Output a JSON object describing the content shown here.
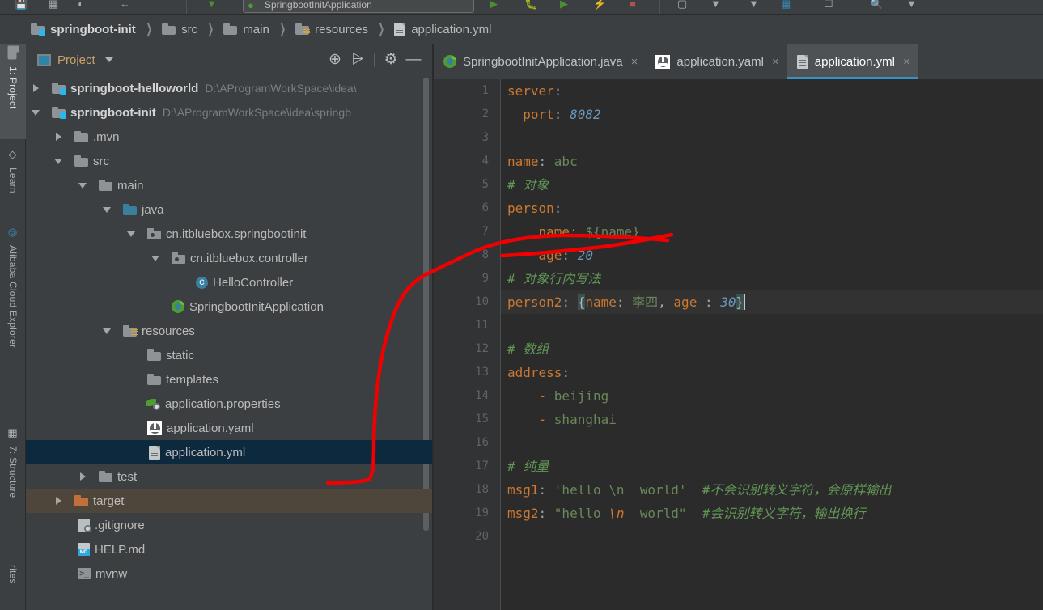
{
  "window": {
    "breadcrumb": [
      {
        "label": "springboot-init",
        "icon": "module-folder-icon",
        "bold": true
      },
      {
        "label": "src",
        "icon": "folder-icon",
        "bold": false
      },
      {
        "label": "main",
        "icon": "folder-icon",
        "bold": false
      },
      {
        "label": "resources",
        "icon": "resources-folder-icon",
        "bold": false
      },
      {
        "label": "application.yml",
        "icon": "yml-file-icon",
        "bold": false
      }
    ],
    "separator": "❯"
  },
  "toolbar": {
    "run_config_name": "SpringbootInitApplication",
    "icons": [
      "save-icon",
      "sync-icon",
      "history-icon",
      "back-icon",
      "forward-icon",
      "build-icon",
      "run-config-dropdown-icon",
      "run-icon",
      "debug-icon",
      "run-coverage-icon",
      "profile-icon",
      "stop-icon",
      "bookmark-icon",
      "search-everywhere-icon",
      "settings-icon",
      "project-structure-icon",
      "layout-icon",
      "search-icon",
      "user-icon"
    ]
  },
  "left_tool_window_bar": {
    "items": [
      {
        "label": "1: Project",
        "icon": "project-icon",
        "active": true
      },
      {
        "label": "Learn",
        "icon": "learn-icon",
        "active": false
      },
      {
        "label": "Alibaba Cloud Explorer",
        "icon": "cloud-icon",
        "active": false
      },
      {
        "label": "7: Structure",
        "icon": "structure-icon",
        "active": false
      },
      {
        "label": "rites",
        "icon": "favorites-icon",
        "active": false
      }
    ]
  },
  "project_panel": {
    "title": "Project",
    "title_caret": "▼",
    "tools": [
      {
        "name": "select-opened-file-icon",
        "glyph": "⊕"
      },
      {
        "name": "collapse-all-icon",
        "glyph": "⩥"
      },
      {
        "name": "settings-gear-icon",
        "glyph": "⚙"
      },
      {
        "name": "hide-panel-icon",
        "glyph": "—"
      }
    ],
    "tree": [
      {
        "indent": 0,
        "arrow": "right",
        "icon": "module-folder-icon",
        "label": "springboot-helloworld",
        "bold": true,
        "path": "D:\\AProgramWorkSpace\\idea\\",
        "state": "normal"
      },
      {
        "indent": 0,
        "arrow": "down",
        "icon": "module-folder-icon",
        "label": "springboot-init",
        "bold": true,
        "path": "D:\\AProgramWorkSpace\\idea\\springb",
        "state": "normal"
      },
      {
        "indent": 1,
        "arrow": "right",
        "icon": "folder-icon",
        "label": ".mvn",
        "bold": false,
        "path": "",
        "state": "normal"
      },
      {
        "indent": 1,
        "arrow": "down",
        "icon": "folder-icon",
        "label": "src",
        "bold": false,
        "path": "",
        "state": "normal"
      },
      {
        "indent": 2,
        "arrow": "down",
        "icon": "folder-icon",
        "label": "main",
        "bold": false,
        "path": "",
        "state": "normal"
      },
      {
        "indent": 3,
        "arrow": "down",
        "icon": "source-folder-icon",
        "label": "java",
        "bold": false,
        "path": "",
        "state": "normal"
      },
      {
        "indent": 4,
        "arrow": "down",
        "icon": "package-icon",
        "label": "cn.itbluebox.springbootinit",
        "bold": false,
        "path": "",
        "state": "normal"
      },
      {
        "indent": 5,
        "arrow": "down",
        "icon": "package-icon",
        "label": "cn.itbluebox.controller",
        "bold": false,
        "path": "",
        "state": "normal"
      },
      {
        "indent": 6,
        "arrow": "none",
        "icon": "java-class-icon",
        "label": "HelloController",
        "bold": false,
        "path": "",
        "state": "normal"
      },
      {
        "indent": 5,
        "arrow": "none",
        "icon": "spring-boot-icon",
        "label": "SpringbootInitApplication",
        "bold": false,
        "path": "",
        "state": "normal"
      },
      {
        "indent": 3,
        "arrow": "down",
        "icon": "resources-folder-icon",
        "label": "resources",
        "bold": false,
        "path": "",
        "state": "normal"
      },
      {
        "indent": 4,
        "arrow": "none",
        "icon": "folder-icon",
        "label": "static",
        "bold": false,
        "path": "",
        "state": "normal"
      },
      {
        "indent": 4,
        "arrow": "none",
        "icon": "folder-icon",
        "label": "templates",
        "bold": false,
        "path": "",
        "state": "normal"
      },
      {
        "indent": 4,
        "arrow": "none",
        "icon": "properties-file-icon",
        "label": "application.properties",
        "bold": false,
        "path": "",
        "state": "normal"
      },
      {
        "indent": 4,
        "arrow": "none",
        "icon": "yaml-rebel-icon",
        "label": "application.yaml",
        "bold": false,
        "path": "",
        "state": "normal"
      },
      {
        "indent": 4,
        "arrow": "none",
        "icon": "yml-file-icon",
        "label": "application.yml",
        "bold": false,
        "path": "",
        "state": "selected"
      },
      {
        "indent": 2,
        "arrow": "right",
        "icon": "folder-icon",
        "label": "test",
        "bold": false,
        "path": "",
        "state": "normal"
      },
      {
        "indent": 1,
        "arrow": "right",
        "icon": "excluded-folder-icon",
        "label": "target",
        "bold": false,
        "path": "",
        "state": "highlighted"
      },
      {
        "indent": 1,
        "arrow": "none",
        "icon": "gitignore-file-icon",
        "label": ".gitignore",
        "bold": false,
        "path": "",
        "state": "normal"
      },
      {
        "indent": 1,
        "arrow": "none",
        "icon": "markdown-file-icon",
        "label": "HELP.md",
        "bold": false,
        "path": "",
        "state": "normal"
      },
      {
        "indent": 1,
        "arrow": "none",
        "icon": "script-file-icon",
        "label": "mvnw",
        "bold": false,
        "path": "",
        "state": "normal"
      }
    ]
  },
  "editor": {
    "tabs": [
      {
        "label": "SpringbootInitApplication.java",
        "icon": "spring-boot-icon",
        "active": false,
        "close": "×"
      },
      {
        "label": "application.yaml",
        "icon": "yaml-rebel-icon",
        "active": false,
        "close": "×"
      },
      {
        "label": "application.yml",
        "icon": "yml-file-icon",
        "active": true,
        "close": "×"
      }
    ],
    "line_numbers": [
      1,
      2,
      3,
      4,
      5,
      6,
      7,
      8,
      9,
      10,
      11,
      12,
      13,
      14,
      15,
      16,
      17,
      18,
      19,
      20
    ],
    "current_line": 10,
    "lines": [
      {
        "n": 1,
        "tokens": [
          {
            "t": "server",
            "c": "k"
          },
          {
            "t": ":",
            "c": "cl"
          }
        ]
      },
      {
        "n": 2,
        "tokens": [
          {
            "t": "  ",
            "c": "p"
          },
          {
            "t": "port",
            "c": "k"
          },
          {
            "t": ": ",
            "c": "cl"
          },
          {
            "t": "8082",
            "c": "n"
          }
        ]
      },
      {
        "n": 3,
        "tokens": []
      },
      {
        "n": 4,
        "tokens": [
          {
            "t": "name",
            "c": "k"
          },
          {
            "t": ": ",
            "c": "cl"
          },
          {
            "t": "abc",
            "c": "s"
          }
        ]
      },
      {
        "n": 5,
        "tokens": [
          {
            "t": "# 对象",
            "c": "cm"
          }
        ]
      },
      {
        "n": 6,
        "tokens": [
          {
            "t": "person",
            "c": "k"
          },
          {
            "t": ":",
            "c": "cl"
          }
        ]
      },
      {
        "n": 7,
        "tokens": [
          {
            "t": "    ",
            "c": "p"
          },
          {
            "t": "name",
            "c": "k"
          },
          {
            "t": ": ",
            "c": "cl"
          },
          {
            "t": "${name}",
            "c": "s"
          }
        ]
      },
      {
        "n": 8,
        "tokens": [
          {
            "t": "    ",
            "c": "p"
          },
          {
            "t": "age",
            "c": "k"
          },
          {
            "t": ": ",
            "c": "cl"
          },
          {
            "t": "20",
            "c": "n"
          }
        ]
      },
      {
        "n": 9,
        "tokens": [
          {
            "t": "# 对象行内写法",
            "c": "cm"
          }
        ]
      },
      {
        "n": 10,
        "tokens": [
          {
            "t": "person2",
            "c": "k"
          },
          {
            "t": ": ",
            "c": "cl"
          },
          {
            "t": "{",
            "c": "brace"
          },
          {
            "t": "name",
            "c": "k"
          },
          {
            "t": ": ",
            "c": "cl"
          },
          {
            "t": "李四",
            "c": "s"
          },
          {
            "t": ", ",
            "c": "cl"
          },
          {
            "t": "age",
            "c": "k"
          },
          {
            "t": " : ",
            "c": "cl"
          },
          {
            "t": "30",
            "c": "n"
          },
          {
            "t": "}",
            "c": "brace"
          }
        ]
      },
      {
        "n": 11,
        "tokens": []
      },
      {
        "n": 12,
        "tokens": [
          {
            "t": "# 数组",
            "c": "cm"
          }
        ]
      },
      {
        "n": 13,
        "tokens": [
          {
            "t": "address",
            "c": "k"
          },
          {
            "t": ":",
            "c": "cl"
          }
        ]
      },
      {
        "n": 14,
        "tokens": [
          {
            "t": "    ",
            "c": "p"
          },
          {
            "t": "- ",
            "c": "k"
          },
          {
            "t": "beijing",
            "c": "s"
          }
        ]
      },
      {
        "n": 15,
        "tokens": [
          {
            "t": "    ",
            "c": "p"
          },
          {
            "t": "- ",
            "c": "k"
          },
          {
            "t": "shanghai",
            "c": "s"
          }
        ]
      },
      {
        "n": 16,
        "tokens": []
      },
      {
        "n": 17,
        "tokens": [
          {
            "t": "# 纯量",
            "c": "cm"
          }
        ]
      },
      {
        "n": 18,
        "tokens": [
          {
            "t": "msg1",
            "c": "k"
          },
          {
            "t": ": ",
            "c": "cl"
          },
          {
            "t": "'hello \\n  world'",
            "c": "s"
          },
          {
            "t": "  ",
            "c": "p"
          },
          {
            "t": "#不会识别转义字符，会原样输出",
            "c": "cm"
          }
        ]
      },
      {
        "n": 19,
        "tokens": [
          {
            "t": "msg2",
            "c": "k"
          },
          {
            "t": ": ",
            "c": "cl"
          },
          {
            "t": "\"hello ",
            "c": "s"
          },
          {
            "t": "\\n",
            "c": "esc"
          },
          {
            "t": "  world\"",
            "c": "s"
          },
          {
            "t": "  ",
            "c": "p"
          },
          {
            "t": "#会识别转义字符，输出换行",
            "c": "cm"
          }
        ]
      },
      {
        "n": 20,
        "tokens": []
      }
    ]
  },
  "annotation": {
    "color": "#f00000",
    "description": "hand-drawn red arc from application.yml tree row up to the name: ${name} line"
  }
}
